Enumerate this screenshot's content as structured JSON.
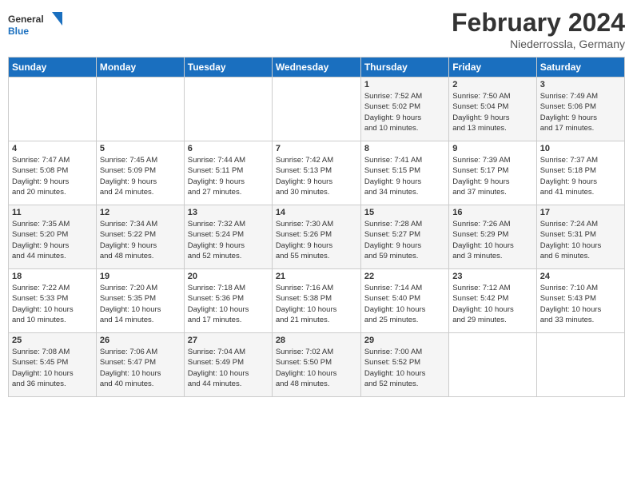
{
  "header": {
    "logo_general": "General",
    "logo_blue": "Blue",
    "month_title": "February 2024",
    "subtitle": "Niederrossla, Germany"
  },
  "days_of_week": [
    "Sunday",
    "Monday",
    "Tuesday",
    "Wednesday",
    "Thursday",
    "Friday",
    "Saturday"
  ],
  "weeks": [
    [
      {
        "day": "",
        "info": ""
      },
      {
        "day": "",
        "info": ""
      },
      {
        "day": "",
        "info": ""
      },
      {
        "day": "",
        "info": ""
      },
      {
        "day": "1",
        "info": "Sunrise: 7:52 AM\nSunset: 5:02 PM\nDaylight: 9 hours\nand 10 minutes."
      },
      {
        "day": "2",
        "info": "Sunrise: 7:50 AM\nSunset: 5:04 PM\nDaylight: 9 hours\nand 13 minutes."
      },
      {
        "day": "3",
        "info": "Sunrise: 7:49 AM\nSunset: 5:06 PM\nDaylight: 9 hours\nand 17 minutes."
      }
    ],
    [
      {
        "day": "4",
        "info": "Sunrise: 7:47 AM\nSunset: 5:08 PM\nDaylight: 9 hours\nand 20 minutes."
      },
      {
        "day": "5",
        "info": "Sunrise: 7:45 AM\nSunset: 5:09 PM\nDaylight: 9 hours\nand 24 minutes."
      },
      {
        "day": "6",
        "info": "Sunrise: 7:44 AM\nSunset: 5:11 PM\nDaylight: 9 hours\nand 27 minutes."
      },
      {
        "day": "7",
        "info": "Sunrise: 7:42 AM\nSunset: 5:13 PM\nDaylight: 9 hours\nand 30 minutes."
      },
      {
        "day": "8",
        "info": "Sunrise: 7:41 AM\nSunset: 5:15 PM\nDaylight: 9 hours\nand 34 minutes."
      },
      {
        "day": "9",
        "info": "Sunrise: 7:39 AM\nSunset: 5:17 PM\nDaylight: 9 hours\nand 37 minutes."
      },
      {
        "day": "10",
        "info": "Sunrise: 7:37 AM\nSunset: 5:18 PM\nDaylight: 9 hours\nand 41 minutes."
      }
    ],
    [
      {
        "day": "11",
        "info": "Sunrise: 7:35 AM\nSunset: 5:20 PM\nDaylight: 9 hours\nand 44 minutes."
      },
      {
        "day": "12",
        "info": "Sunrise: 7:34 AM\nSunset: 5:22 PM\nDaylight: 9 hours\nand 48 minutes."
      },
      {
        "day": "13",
        "info": "Sunrise: 7:32 AM\nSunset: 5:24 PM\nDaylight: 9 hours\nand 52 minutes."
      },
      {
        "day": "14",
        "info": "Sunrise: 7:30 AM\nSunset: 5:26 PM\nDaylight: 9 hours\nand 55 minutes."
      },
      {
        "day": "15",
        "info": "Sunrise: 7:28 AM\nSunset: 5:27 PM\nDaylight: 9 hours\nand 59 minutes."
      },
      {
        "day": "16",
        "info": "Sunrise: 7:26 AM\nSunset: 5:29 PM\nDaylight: 10 hours\nand 3 minutes."
      },
      {
        "day": "17",
        "info": "Sunrise: 7:24 AM\nSunset: 5:31 PM\nDaylight: 10 hours\nand 6 minutes."
      }
    ],
    [
      {
        "day": "18",
        "info": "Sunrise: 7:22 AM\nSunset: 5:33 PM\nDaylight: 10 hours\nand 10 minutes."
      },
      {
        "day": "19",
        "info": "Sunrise: 7:20 AM\nSunset: 5:35 PM\nDaylight: 10 hours\nand 14 minutes."
      },
      {
        "day": "20",
        "info": "Sunrise: 7:18 AM\nSunset: 5:36 PM\nDaylight: 10 hours\nand 17 minutes."
      },
      {
        "day": "21",
        "info": "Sunrise: 7:16 AM\nSunset: 5:38 PM\nDaylight: 10 hours\nand 21 minutes."
      },
      {
        "day": "22",
        "info": "Sunrise: 7:14 AM\nSunset: 5:40 PM\nDaylight: 10 hours\nand 25 minutes."
      },
      {
        "day": "23",
        "info": "Sunrise: 7:12 AM\nSunset: 5:42 PM\nDaylight: 10 hours\nand 29 minutes."
      },
      {
        "day": "24",
        "info": "Sunrise: 7:10 AM\nSunset: 5:43 PM\nDaylight: 10 hours\nand 33 minutes."
      }
    ],
    [
      {
        "day": "25",
        "info": "Sunrise: 7:08 AM\nSunset: 5:45 PM\nDaylight: 10 hours\nand 36 minutes."
      },
      {
        "day": "26",
        "info": "Sunrise: 7:06 AM\nSunset: 5:47 PM\nDaylight: 10 hours\nand 40 minutes."
      },
      {
        "day": "27",
        "info": "Sunrise: 7:04 AM\nSunset: 5:49 PM\nDaylight: 10 hours\nand 44 minutes."
      },
      {
        "day": "28",
        "info": "Sunrise: 7:02 AM\nSunset: 5:50 PM\nDaylight: 10 hours\nand 48 minutes."
      },
      {
        "day": "29",
        "info": "Sunrise: 7:00 AM\nSunset: 5:52 PM\nDaylight: 10 hours\nand 52 minutes."
      },
      {
        "day": "",
        "info": ""
      },
      {
        "day": "",
        "info": ""
      }
    ]
  ]
}
